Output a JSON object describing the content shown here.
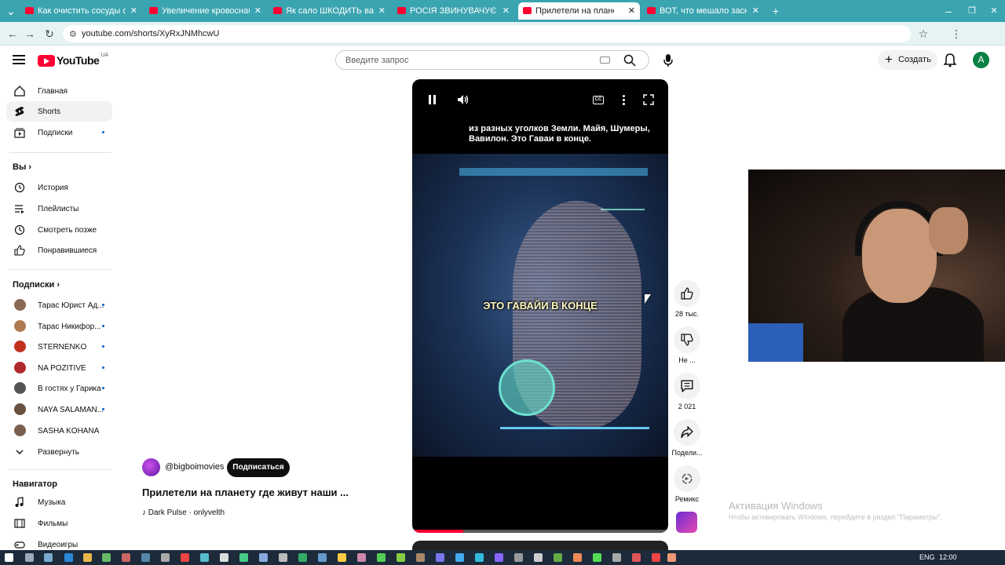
{
  "browser": {
    "tabs": [
      {
        "label": "Как очистить сосуды от бляшек"
      },
      {
        "label": "Увеличение кровоснабжения"
      },
      {
        "label": "Як сало ШКОДИТЬ вашому здо"
      },
      {
        "label": "РОСІЯ ЗВИНУВАЧУЄ УКРАЇНУ"
      },
      {
        "label": "Прилетели на планету где"
      },
      {
        "label": "ВОТ, что мешало заснуть! Как"
      }
    ],
    "url": "youtube.com/shorts/XyRxJNMhcwU"
  },
  "header": {
    "logo": "YouTube",
    "country": "UA",
    "search_placeholder": "Введите запрос",
    "create_label": "Создать",
    "avatar_letter": "A"
  },
  "sidebar": {
    "main": [
      {
        "label": "Главная",
        "icon": "home-icon"
      },
      {
        "label": "Shorts",
        "icon": "shorts-icon"
      },
      {
        "label": "Подписки",
        "icon": "subscriptions-icon"
      }
    ],
    "you_header": "Вы",
    "you": [
      {
        "label": "История",
        "icon": "history-icon"
      },
      {
        "label": "Плейлисты",
        "icon": "playlists-icon"
      },
      {
        "label": "Смотреть позже",
        "icon": "watch-later-icon"
      },
      {
        "label": "Понравившиеся",
        "icon": "like-icon"
      }
    ],
    "subs_header": "Подписки",
    "subs": [
      {
        "label": "Тарас Юрист Ад...",
        "color": "#8a6a55"
      },
      {
        "label": "Тарас Никифор...",
        "color": "#b07a50"
      },
      {
        "label": "STERNENKO",
        "color": "#c03020"
      },
      {
        "label": "NA POZITIVE",
        "color": "#b0282e"
      },
      {
        "label": "В гостях у Гарика",
        "color": "#555555"
      },
      {
        "label": "NAYA SALAMAN...",
        "color": "#6a5040"
      },
      {
        "label": "SASHA KOHANA",
        "color": "#7a6050"
      }
    ],
    "expand_label": "Развернуть",
    "nav_header": "Навигатор",
    "nav": [
      {
        "label": "Музыка",
        "icon": "music-icon"
      },
      {
        "label": "Фильмы",
        "icon": "film-icon"
      },
      {
        "label": "Видеоигры",
        "icon": "gamepad-icon"
      }
    ]
  },
  "player": {
    "subtitle_top": "из разных уголков Земли. Майя, Шумеры, Вавилон. Это Гаваи в конце.",
    "caption": "ЭТО ГАВАЙИ В КОНЦЕ",
    "progress": 0.2
  },
  "actions": {
    "likes": "28 тыс.",
    "dislike": "Не ...",
    "comments": "2 021",
    "share": "Подели...",
    "remix": "Ремикс"
  },
  "channel": {
    "handle": "@bigboimovies",
    "subscribe_label": "Подписаться",
    "title": "Прилетели на планету где живут наши ...",
    "music": "Dark Pulse · onlyvelth"
  },
  "watermark": {
    "title": "Активация Windows",
    "subtitle": "Чтобы активировать Windows, перейдите в раздел \"Параметры\"."
  },
  "taskbar": {
    "lang": "ENG",
    "time": "12:00"
  }
}
